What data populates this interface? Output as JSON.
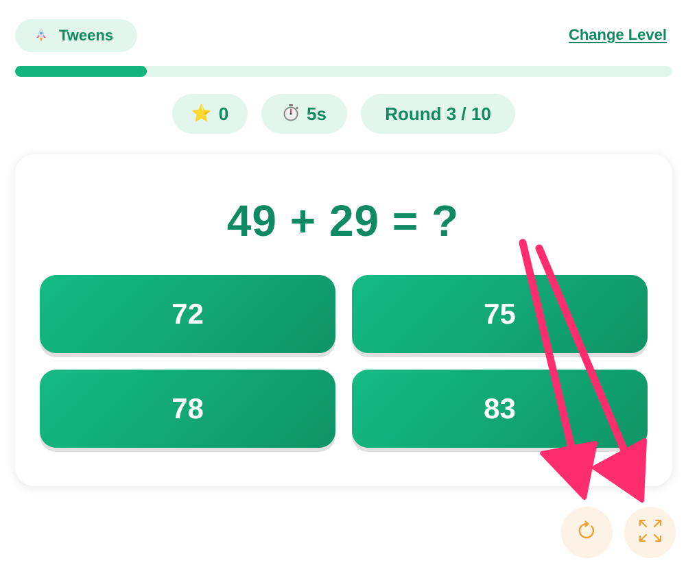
{
  "header": {
    "level_label": "Tweens",
    "level_icon": "rocket-icon",
    "change_level_label": "Change Level"
  },
  "progress": {
    "fraction": 0.2
  },
  "stats": {
    "stars_icon": "star-icon",
    "stars": "0",
    "timer_icon": "stopwatch-icon",
    "timer": "5s",
    "round": "Round 3 / 10"
  },
  "question": {
    "text": "49 + 29 = ?"
  },
  "answers": [
    "72",
    "75",
    "78",
    "83"
  ],
  "controls": {
    "restart_icon": "restart-icon",
    "fullscreen_icon": "fullscreen-icon"
  },
  "colors": {
    "primary": "#12b57e",
    "text_green": "#0f8a62",
    "pill_bg": "#e3f6ee",
    "control_bg": "#fdf2e6",
    "control_icon": "#f0a030",
    "annotation_arrow": "#ff2d6f"
  }
}
